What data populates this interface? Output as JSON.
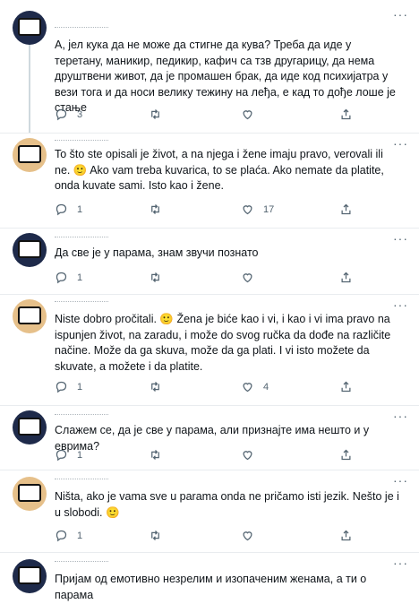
{
  "tweets": [
    {
      "text": "А, јел кука да не може да стигне да кува? Треба да иде у теретану, маникир, педикир, кафич са тзв другарицу, да нема друштвени живот, да је промашен брак, да иде код психијатра у вези тога и да носи велику тежину на леђа, е кад то дође лоше је стање",
      "replies": "3",
      "retweets": "",
      "likes": "",
      "avatar_color": "#1e2a4a"
    },
    {
      "text": "To što ste opisali je život, a na njega i žene imaju pravo, verovali ili ne. 🙂 Ako vam treba kuvarica, to se plaća. Ako nemate da platite, onda kuvate sami. Isto kao i žene.",
      "replies": "1",
      "retweets": "",
      "likes": "17",
      "avatar_color": "#e6c08a"
    },
    {
      "text": "Да све је у парама, знам звучи познато",
      "replies": "1",
      "retweets": "",
      "likes": "",
      "avatar_color": "#1e2a4a"
    },
    {
      "text": "Niste dobro pročitali. 🙂 Žena je biće kao i vi, i kao i vi ima pravo na ispunjen život, na zaradu, i može do svog ručka da dođe na različite načine. Može da ga skuva, može da ga plati. I vi isto možete da skuvate, a možete i da platite.",
      "replies": "1",
      "retweets": "",
      "likes": "4",
      "avatar_color": "#e6c08a"
    },
    {
      "text": "Слажем се, да је све у парама, али признајте има нешто и у еврима?",
      "replies": "1",
      "retweets": "",
      "likes": "",
      "avatar_color": "#1e2a4a"
    },
    {
      "text": "Ništa, ako je vama sve u parama onda ne pričamo isti jezik. Nešto je i u slobodi. 🙂",
      "replies": "1",
      "retweets": "",
      "likes": "",
      "avatar_color": "#e6c08a"
    },
    {
      "text": "Пријам од емотивно незрелим и изопаченим женама, а ти о парама",
      "replies": "",
      "retweets": "",
      "likes": "",
      "avatar_color": "#1e2a4a"
    }
  ],
  "icons": {
    "reply": "reply-icon",
    "retweet": "retweet-icon",
    "like": "heart-icon",
    "share": "share-icon",
    "more": "more-icon"
  },
  "more_label": "···"
}
